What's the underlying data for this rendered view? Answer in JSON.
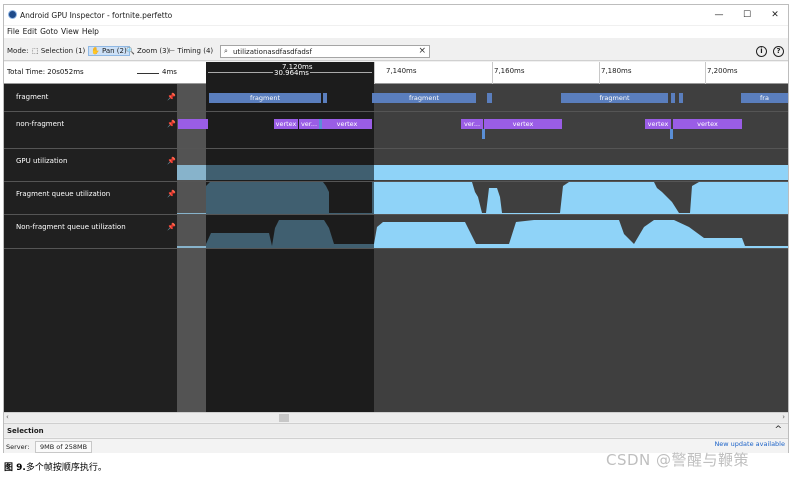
{
  "window": {
    "title": "Android GPU Inspector - fortnite.perfetto",
    "controls": [
      "—",
      "☐",
      "✕"
    ]
  },
  "menu": [
    "File",
    "Edit",
    "Goto",
    "View",
    "Help"
  ],
  "toolbar": {
    "mode_label": "Mode:",
    "modes": [
      {
        "icon": "selection-icon",
        "glyph": "⬚",
        "label": "Selection (1)",
        "active": false
      },
      {
        "icon": "hand-icon",
        "glyph": "✋",
        "label": "Pan (2)",
        "active": true
      },
      {
        "icon": "zoom-icon",
        "glyph": "🔍",
        "label": "Zoom (3)",
        "active": false
      },
      {
        "icon": "timing-icon",
        "glyph": "⊢",
        "label": "Timing (4)",
        "active": false
      }
    ],
    "search_value": "utilizationasdfasdfadsf",
    "info_glyph": "i",
    "help_glyph": "?"
  },
  "timeline": {
    "total_time": "Total Time: 20s052ms",
    "scale": "4ms",
    "selection_start": "7,120ms",
    "selection_duration": "30.964ms",
    "ticks": [
      "7,140ms",
      "7,160ms",
      "7,180ms",
      "7,200ms"
    ]
  },
  "tracks": [
    {
      "label": "fragment",
      "slices": [
        "fragment",
        "fragment",
        "fragment",
        "fra"
      ]
    },
    {
      "label": "non-fragment",
      "slices": [
        "vertex",
        "ver...",
        "vertex",
        "ver...",
        "vertex",
        "vertex",
        "vertex"
      ]
    },
    {
      "label": "GPU utilization"
    },
    {
      "label": "Fragment queue utilization"
    },
    {
      "label": "Non-fragment queue utilization"
    }
  ],
  "colors": {
    "fragment": "#5a7ebd",
    "vertex": "#9a5de6",
    "utilization": "#8fd3f8"
  },
  "selection": {
    "title": "Selection"
  },
  "status": {
    "server_label": "Server:",
    "memory": "9MB of 258MB",
    "update": "New update available"
  },
  "caption": {
    "figure": "图 9.",
    "text": "多个帧按顺序执行。"
  },
  "watermark": "CSDN @警醒与鞭策"
}
